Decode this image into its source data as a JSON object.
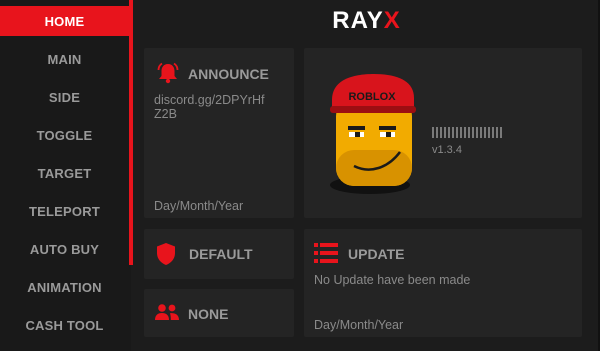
{
  "app": {
    "title_part1": "RAY",
    "title_part2": "X"
  },
  "sidebar": {
    "items": [
      {
        "label": "HOME",
        "active": true
      },
      {
        "label": "MAIN"
      },
      {
        "label": "SIDE"
      },
      {
        "label": "TOGGLE"
      },
      {
        "label": "TARGET"
      },
      {
        "label": "TELEPORT"
      },
      {
        "label": "AUTO BUY"
      },
      {
        "label": "ANIMATION"
      },
      {
        "label": "CASH TOOL"
      }
    ]
  },
  "announce": {
    "title": "ANNOUNCE",
    "text_line1": "discord.gg/2DPYrHf",
    "text_line2": "Z2B",
    "date": "Day/Month/Year",
    "icon": "bell-icon"
  },
  "profile": {
    "hat_text": "ROBLOX",
    "version": "v1.3.4"
  },
  "default": {
    "label": "DEFAULT",
    "icon": "shield-icon"
  },
  "none": {
    "label": "NONE",
    "icon": "users-icon"
  },
  "update": {
    "title": "UPDATE",
    "text": "No Update have been made",
    "date": "Day/Month/Year",
    "icon": "list-icon"
  },
  "colors": {
    "accent": "#e8141c",
    "background": "#1c1c1c",
    "card": "#242424",
    "text_muted": "#9a9a9a"
  }
}
